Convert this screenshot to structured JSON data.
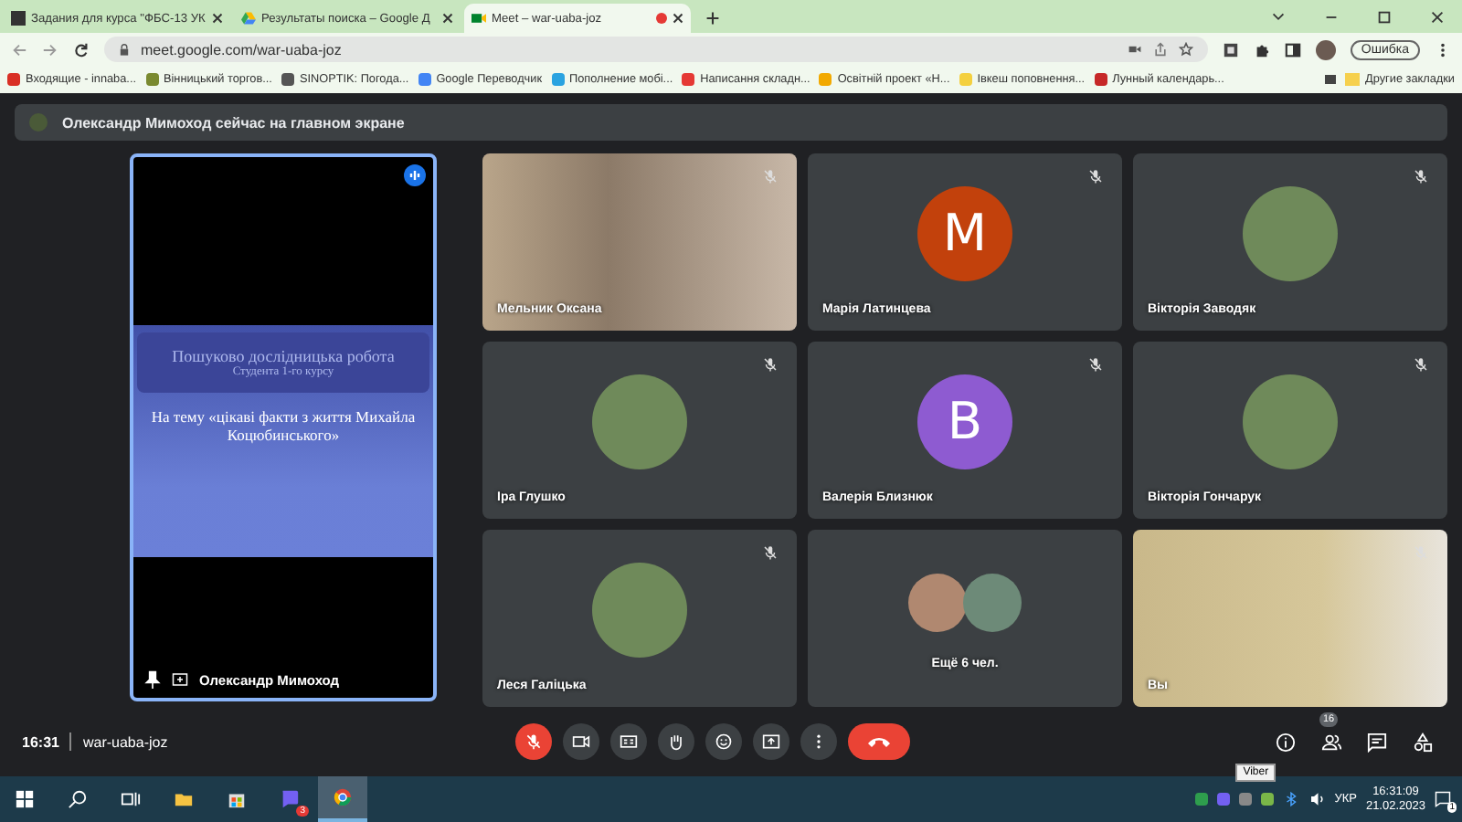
{
  "browser": {
    "tabs": [
      {
        "title": "Задания для курса \"ФБС-13 УК",
        "selected": false,
        "kind": "doc"
      },
      {
        "title": "Результаты поиска – Google Д",
        "selected": false,
        "kind": "drive"
      },
      {
        "title": "Meet – war-uaba-joz",
        "selected": true,
        "kind": "meet",
        "recording": true
      }
    ],
    "address": "meet.google.com/war-uaba-joz",
    "profile_button": "Ошибка",
    "bookmarks": [
      {
        "label": "Входящие - innaba...",
        "color": "#d93025"
      },
      {
        "label": "Вінницький торгов...",
        "color": "#7a8a30"
      },
      {
        "label": "SINOPTIK: Погода...",
        "color": "#555555"
      },
      {
        "label": "Google Переводчик",
        "color": "#4285f4"
      },
      {
        "label": "Пополнение мобі...",
        "color": "#2aa3e0"
      },
      {
        "label": "Написання складн...",
        "color": "#e53935"
      },
      {
        "label": "Освітній проект «Н...",
        "color": "#f2a900"
      },
      {
        "label": "Івкеш поповнення...",
        "color": "#f4d03f"
      },
      {
        "label": "Лунный календарь...",
        "color": "#c62828"
      }
    ],
    "other_bookmarks": "Другие закладки"
  },
  "meet": {
    "banner": "Олександр Мимоход сейчас на главном экране",
    "presenter": {
      "name": "Олександр Мимоход",
      "speaking": true,
      "pinned": true,
      "slide": {
        "title": "Пошуково дослідницька робота",
        "subtitle": "Студента 1-го курсу",
        "body": "На тему «цікаві факти з життя Михайла Коцюбинського»"
      }
    },
    "tiles": [
      {
        "kind": "video",
        "name": "Мельник Оксана",
        "muted": true
      },
      {
        "kind": "letter",
        "name": "Марія Латинцева",
        "letter": "M",
        "color": "#c2410c",
        "muted": true
      },
      {
        "kind": "photo",
        "name": "Вікторія Заводяк",
        "muted": true
      },
      {
        "kind": "photo",
        "name": "Іра Глушко",
        "muted": true
      },
      {
        "kind": "letter",
        "name": "Валерія Близнюк",
        "letter": "B",
        "color": "#8e5bd1",
        "muted": true
      },
      {
        "kind": "photo",
        "name": "Вікторія Гончарук",
        "muted": true
      },
      {
        "kind": "photo",
        "name": "Леся Галіцька",
        "muted": true
      },
      {
        "kind": "group",
        "name": "Ещё 6 чел.",
        "muted": false
      },
      {
        "kind": "self",
        "name": "Вы",
        "muted": true
      }
    ],
    "time": "16:31",
    "code": "war-uaba-joz",
    "mic_muted": true,
    "participants_count": "16"
  },
  "taskbar": {
    "viber_badge": "3",
    "tooltip": "Viber",
    "language": "УКР",
    "time": "16:31:09",
    "date": "21.02.2023",
    "notifications": "1"
  }
}
